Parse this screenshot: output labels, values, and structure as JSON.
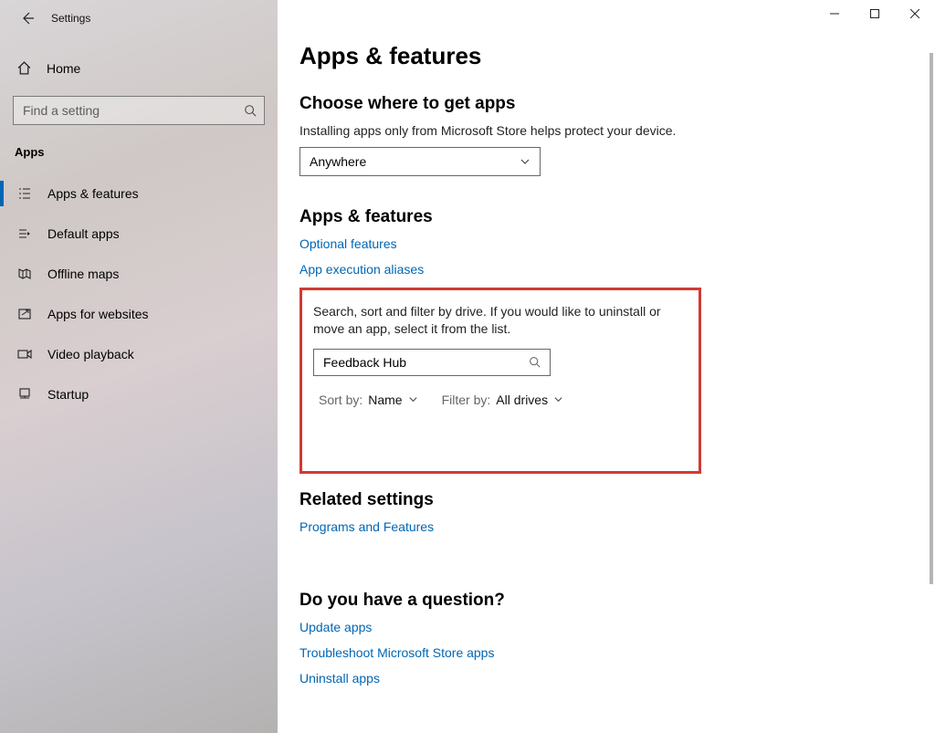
{
  "window": {
    "title": "Settings"
  },
  "sidebar": {
    "home": "Home",
    "search_placeholder": "Find a setting",
    "section": "Apps",
    "items": [
      {
        "label": "Apps & features",
        "icon": "list-icon",
        "active": true
      },
      {
        "label": "Default apps",
        "icon": "default-apps-icon"
      },
      {
        "label": "Offline maps",
        "icon": "map-icon"
      },
      {
        "label": "Apps for websites",
        "icon": "websites-icon"
      },
      {
        "label": "Video playback",
        "icon": "video-icon"
      },
      {
        "label": "Startup",
        "icon": "startup-icon"
      }
    ]
  },
  "main": {
    "title": "Apps & features",
    "choose": {
      "heading": "Choose where to get apps",
      "desc": "Installing apps only from Microsoft Store helps protect your device.",
      "selected": "Anywhere"
    },
    "apps_features": {
      "heading": "Apps & features",
      "link_optional": "Optional features",
      "link_aliases": "App execution aliases",
      "filter_desc": "Search, sort and filter by drive. If you would like to uninstall or move an app, select it from the list.",
      "search_value": "Feedback Hub",
      "sort_label": "Sort by:",
      "sort_value": "Name",
      "filter_label": "Filter by:",
      "filter_value": "All drives"
    },
    "related": {
      "heading": "Related settings",
      "link_programs": "Programs and Features"
    },
    "question": {
      "heading": "Do you have a question?",
      "link_update": "Update apps",
      "link_trouble": "Troubleshoot Microsoft Store apps",
      "link_uninstall": "Uninstall apps"
    }
  }
}
